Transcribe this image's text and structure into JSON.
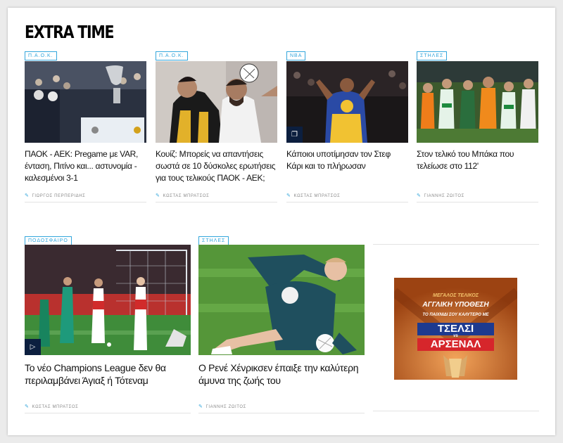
{
  "section": {
    "title": "EXTRA TIME"
  },
  "articles_top": [
    {
      "tag": "Π.Α.Ο.Κ.",
      "headline": "ΠΑΟΚ - ΑΕΚ: Pregame με VAR, ένταση, Πιτίνο και... αστυνομία - καλεσμένοι 3-1",
      "author": "ΓΙΩΡΓΟΣ ΠΕΡΠΕΡΙΔΗΣ"
    },
    {
      "tag": "Π.Α.Ο.Κ.",
      "headline": "Κουίζ: Μπορείς να απαντήσεις σωστά σε 10 δύσκολες ερωτήσεις για τους τελικούς ΠΑΟΚ - ΑΕΚ;",
      "author": "ΚΩΣΤΑΣ ΜΠΡΑΤΣΟΣ"
    },
    {
      "tag": "NBA",
      "headline": "Κάποιοι υποτίμησαν τον Στεφ Κάρι και το πλήρωσαν",
      "author": "ΚΩΣΤΑΣ ΜΠΡΑΤΣΟΣ"
    },
    {
      "tag": "ΣΤΗΛΕΣ",
      "headline": "Στον τελικό του Μπάκα που τελείωσε στο 112'",
      "author": "ΓΙΑΝΝΗΣ ΖΩΙΤΟΣ"
    }
  ],
  "articles_bottom": [
    {
      "tag": "ΠΟΔΟΣΦΑΙΡΟ",
      "headline": "Το νέο Champions League δεν θα περιλαμβάνει Άγιαξ ή Τότεναμ",
      "author": "ΚΩΣΤΑΣ ΜΠΡΑΤΣΟΣ"
    },
    {
      "tag": "ΣΤΗΛΕΣ",
      "headline": "Ο Ρενέ Χένρικσεν έπαιξε την καλύτερη άμυνα της ζωής του",
      "author": "ΓΙΑΝΝΗΣ ΖΩΙΤΟΣ"
    }
  ],
  "ad": {
    "line1": "ΜΕΓΑΛΟΣ ΤΕΛΙΚΟΣ",
    "line2": "ΑΓΓΛΙΚΗ ΥΠΟΘΕΣΗ",
    "line3": "ΤΟ ΠΑΙΧΝΙΔΙ ΣΟΥ ΚΑΛΥΤΕΡΟ ΜΕ",
    "team1": "ΤΣΕΛΣΙ",
    "vs": "vs",
    "team2": "ΑΡΣΕΝΑΛ"
  },
  "icons": {
    "author": "pen-icon",
    "gallery": "gallery-icon",
    "video": "play-icon"
  },
  "colors": {
    "tag": "#33a6dc",
    "badge": "#0c1f3f",
    "ad_bg": "#c8641e",
    "ad_blue": "#1d3a8f",
    "ad_red": "#d6262b"
  }
}
